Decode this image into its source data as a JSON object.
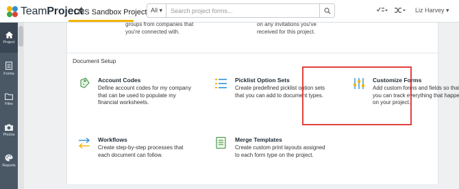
{
  "header": {
    "logo_text_bold": "Project",
    "logo_text_light": "Team",
    "project_label": "LMS Sandbox Project",
    "project_caret": "▾",
    "search_scope": "All ▾",
    "search_placeholder": "Search project forms...",
    "user_name": "Liz Harvey ▾",
    "accent_color": "#f4b400"
  },
  "sidebar": {
    "items": [
      {
        "label": "Project",
        "icon": "home-icon"
      },
      {
        "label": "Forms",
        "icon": "document-icon"
      },
      {
        "label": "Files",
        "icon": "folder-icon"
      },
      {
        "label": "Photos",
        "icon": "camera-icon"
      },
      {
        "label": "Reports",
        "icon": "palette-icon"
      }
    ]
  },
  "previous_section": {
    "left_line1": "groups from companies that",
    "left_line2": "you're connected with.",
    "right_line1": "on any invitations you've",
    "right_line2": "received for this project."
  },
  "document_setup": {
    "title": "Document Setup",
    "items": [
      {
        "title": "Account Codes",
        "desc": "Define account codes for my company that can be used to populate my financial worksheets.",
        "icon": "price-tag-icon"
      },
      {
        "title": "Picklist Option Sets",
        "desc": "Create predefined picklist option sets that you can add to document types.",
        "icon": "list-icon"
      },
      {
        "title": "Customize Forms",
        "desc": "Add custom forms and fields so that you can track everything that happens on your project.",
        "icon": "sliders-icon"
      },
      {
        "title": "Workflows",
        "desc": "Create step-by-step processes that each document can follow.",
        "icon": "arrows-icon"
      },
      {
        "title": "Merge Templates",
        "desc": "Create custom print layouts assigned to each form type on the project.",
        "icon": "template-icon"
      }
    ]
  }
}
